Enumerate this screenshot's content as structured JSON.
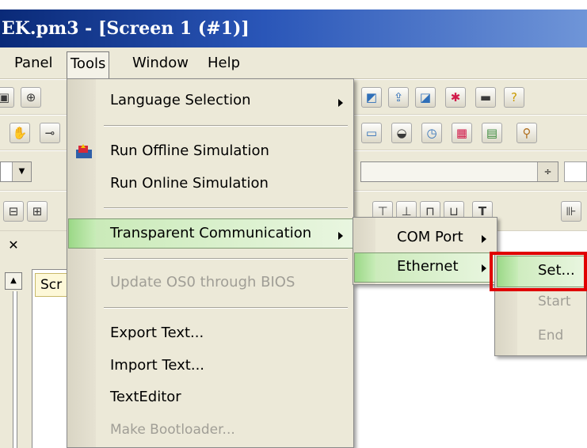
{
  "window": {
    "title": "EK.pm3 - [Screen 1 (#1)]"
  },
  "menubar": {
    "items": [
      "Panel",
      "Tools",
      "Window",
      "Help"
    ]
  },
  "document": {
    "tab_label": "Scr"
  },
  "tools_menu": {
    "items": [
      {
        "label": "Language Selection",
        "enabled": true,
        "submenu": true
      },
      {
        "label": "Run Offline Simulation",
        "enabled": true
      },
      {
        "label": "Run Online Simulation",
        "enabled": true
      },
      {
        "label": "Transparent Communication",
        "enabled": true,
        "submenu": true,
        "highlighted": true
      },
      {
        "label": "Update OS0 through BIOS",
        "enabled": false
      },
      {
        "label": "Export Text...",
        "enabled": true
      },
      {
        "label": "Import Text...",
        "enabled": true
      },
      {
        "label": "TextEditor",
        "enabled": true
      },
      {
        "label": "Make Bootloader...",
        "enabled": false
      }
    ]
  },
  "transparent_submenu": {
    "items": [
      {
        "label": "COM Port",
        "submenu": true
      },
      {
        "label": "Ethernet",
        "submenu": true,
        "highlighted": true
      }
    ]
  },
  "ethernet_submenu": {
    "items": [
      {
        "label": "Set...",
        "enabled": true,
        "highlighted": true
      },
      {
        "label": "Start",
        "enabled": false
      },
      {
        "label": "End",
        "enabled": false
      }
    ]
  },
  "colors": {
    "highlight": "#c7e9b5",
    "annotation": "#e00000",
    "title_bar": "#0a2a78"
  },
  "icons": [
    "save-icon",
    "zoom-icon",
    "simulation-icon",
    "help-icon",
    "clock-icon",
    "calendar-icon",
    "close-icon",
    "scroll-up-icon"
  ]
}
